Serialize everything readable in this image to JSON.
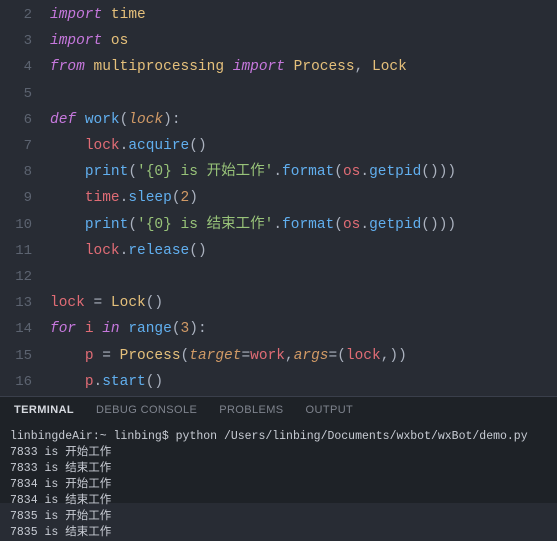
{
  "editor": {
    "lineStart": 2,
    "lines": [
      [
        {
          "c": "kw",
          "t": "import"
        },
        {
          "c": "p",
          "t": " "
        },
        {
          "c": "mod",
          "t": "time"
        }
      ],
      [
        {
          "c": "kw",
          "t": "import"
        },
        {
          "c": "p",
          "t": " "
        },
        {
          "c": "mod",
          "t": "os"
        }
      ],
      [
        {
          "c": "kw",
          "t": "from"
        },
        {
          "c": "p",
          "t": " "
        },
        {
          "c": "mod",
          "t": "multiprocessing"
        },
        {
          "c": "p",
          "t": " "
        },
        {
          "c": "kw",
          "t": "import"
        },
        {
          "c": "p",
          "t": " "
        },
        {
          "c": "mod",
          "t": "Process"
        },
        {
          "c": "p",
          "t": ", "
        },
        {
          "c": "mod",
          "t": "Lock"
        }
      ],
      [],
      [
        {
          "c": "def",
          "t": "def"
        },
        {
          "c": "p",
          "t": " "
        },
        {
          "c": "name",
          "t": "work"
        },
        {
          "c": "p",
          "t": "("
        },
        {
          "c": "param",
          "t": "lock"
        },
        {
          "c": "p",
          "t": "):"
        }
      ],
      [
        {
          "c": "p",
          "t": "    "
        },
        {
          "c": "var",
          "t": "lock"
        },
        {
          "c": "p",
          "t": "."
        },
        {
          "c": "call",
          "t": "acquire"
        },
        {
          "c": "p",
          "t": "()"
        }
      ],
      [
        {
          "c": "p",
          "t": "    "
        },
        {
          "c": "call",
          "t": "print"
        },
        {
          "c": "p",
          "t": "("
        },
        {
          "c": "str",
          "t": "'{0} is 开始工作'"
        },
        {
          "c": "p",
          "t": "."
        },
        {
          "c": "call",
          "t": "format"
        },
        {
          "c": "p",
          "t": "("
        },
        {
          "c": "var",
          "t": "os"
        },
        {
          "c": "p",
          "t": "."
        },
        {
          "c": "call",
          "t": "getpid"
        },
        {
          "c": "p",
          "t": "()))"
        }
      ],
      [
        {
          "c": "p",
          "t": "    "
        },
        {
          "c": "var",
          "t": "time"
        },
        {
          "c": "p",
          "t": "."
        },
        {
          "c": "call",
          "t": "sleep"
        },
        {
          "c": "p",
          "t": "("
        },
        {
          "c": "num",
          "t": "2"
        },
        {
          "c": "p",
          "t": ")"
        }
      ],
      [
        {
          "c": "p",
          "t": "    "
        },
        {
          "c": "call",
          "t": "print"
        },
        {
          "c": "p",
          "t": "("
        },
        {
          "c": "str",
          "t": "'{0} is 结束工作'"
        },
        {
          "c": "p",
          "t": "."
        },
        {
          "c": "call",
          "t": "format"
        },
        {
          "c": "p",
          "t": "("
        },
        {
          "c": "var",
          "t": "os"
        },
        {
          "c": "p",
          "t": "."
        },
        {
          "c": "call",
          "t": "getpid"
        },
        {
          "c": "p",
          "t": "()))"
        }
      ],
      [
        {
          "c": "p",
          "t": "    "
        },
        {
          "c": "var",
          "t": "lock"
        },
        {
          "c": "p",
          "t": "."
        },
        {
          "c": "call",
          "t": "release"
        },
        {
          "c": "p",
          "t": "()"
        }
      ],
      [],
      [
        {
          "c": "var",
          "t": "lock"
        },
        {
          "c": "p",
          "t": " = "
        },
        {
          "c": "obj",
          "t": "Lock"
        },
        {
          "c": "p",
          "t": "()"
        }
      ],
      [
        {
          "c": "kw",
          "t": "for"
        },
        {
          "c": "p",
          "t": " "
        },
        {
          "c": "var",
          "t": "i"
        },
        {
          "c": "p",
          "t": " "
        },
        {
          "c": "kw",
          "t": "in"
        },
        {
          "c": "p",
          "t": " "
        },
        {
          "c": "call",
          "t": "range"
        },
        {
          "c": "p",
          "t": "("
        },
        {
          "c": "num",
          "t": "3"
        },
        {
          "c": "p",
          "t": "):"
        }
      ],
      [
        {
          "c": "p",
          "t": "    "
        },
        {
          "c": "var",
          "t": "p"
        },
        {
          "c": "p",
          "t": " = "
        },
        {
          "c": "obj",
          "t": "Process"
        },
        {
          "c": "p",
          "t": "("
        },
        {
          "c": "param",
          "t": "target"
        },
        {
          "c": "p",
          "t": "="
        },
        {
          "c": "var",
          "t": "work"
        },
        {
          "c": "p",
          "t": ","
        },
        {
          "c": "param",
          "t": "args"
        },
        {
          "c": "p",
          "t": "=("
        },
        {
          "c": "var",
          "t": "lock"
        },
        {
          "c": "p",
          "t": ",))"
        }
      ],
      [
        {
          "c": "p",
          "t": "    "
        },
        {
          "c": "var",
          "t": "p"
        },
        {
          "c": "p",
          "t": "."
        },
        {
          "c": "call",
          "t": "start"
        },
        {
          "c": "p",
          "t": "()"
        }
      ]
    ]
  },
  "panel": {
    "tabs": [
      "TERMINAL",
      "DEBUG CONSOLE",
      "PROBLEMS",
      "OUTPUT"
    ],
    "active": 0
  },
  "terminal": {
    "prompt_host": "linbingdeAir:~ linbing$",
    "command": "python /Users/linbing/Documents/wxbot/wxBot/demo.py",
    "output": [
      "7833 is 开始工作",
      "7833 is 结束工作",
      "7834 is 开始工作",
      "7834 is 结束工作",
      "7835 is 开始工作",
      "7835 is 结束工作"
    ]
  }
}
